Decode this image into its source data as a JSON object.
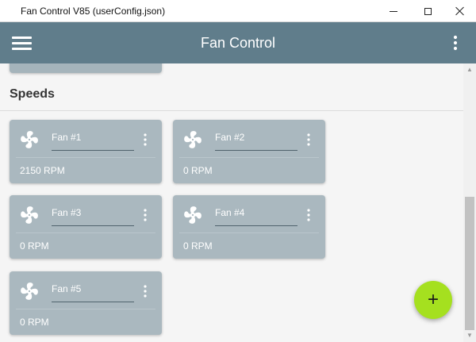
{
  "window": {
    "title": "Fan Control V85 (userConfig.json)"
  },
  "appbar": {
    "title": "Fan Control",
    "menu_icon": "hamburger-menu-icon",
    "more_icon": "more-vertical-icon",
    "color": "#607d8b"
  },
  "section": {
    "title": "Speeds"
  },
  "cards": [
    {
      "name": "Fan #1",
      "rpm": "2150 RPM"
    },
    {
      "name": "Fan #2",
      "rpm": "0 RPM"
    },
    {
      "name": "Fan #3",
      "rpm": "0 RPM"
    },
    {
      "name": "Fan #4",
      "rpm": "0 RPM"
    },
    {
      "name": "Fan #5",
      "rpm": "0 RPM"
    }
  ],
  "card_icon": "fan-icon",
  "card_color": "#aab8bf",
  "fab": {
    "label": "+",
    "color": "#a5e01f"
  }
}
